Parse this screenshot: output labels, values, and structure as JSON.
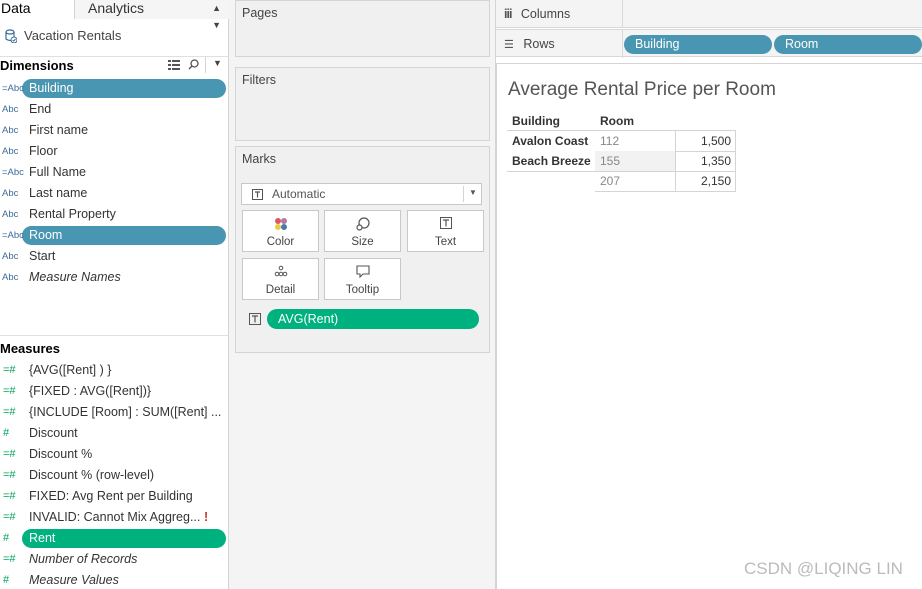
{
  "data_pane": {
    "tab_data": "Data",
    "tab_analytics": "Analytics",
    "datasource": "Vacation Rentals",
    "dimensions_header": "Dimensions",
    "dimensions": [
      {
        "type": "=Abc",
        "name": "Building",
        "selected": true
      },
      {
        "type": "Abc",
        "name": "End"
      },
      {
        "type": "Abc",
        "name": "First name"
      },
      {
        "type": "Abc",
        "name": "Floor"
      },
      {
        "type": "=Abc",
        "name": "Full Name"
      },
      {
        "type": "Abc",
        "name": "Last name"
      },
      {
        "type": "Abc",
        "name": "Rental Property"
      },
      {
        "type": "=Abc",
        "name": "Room",
        "selected": true
      },
      {
        "type": "Abc",
        "name": "Start"
      },
      {
        "type": "Abc",
        "name": "Measure Names",
        "italic": true
      }
    ],
    "measures_header": "Measures",
    "measures": [
      {
        "type": "=#",
        "name": "{AVG([Rent] ) }"
      },
      {
        "type": "=#",
        "name": "{FIXED : AVG([Rent])}"
      },
      {
        "type": "=#",
        "name": "{INCLUDE [Room] : SUM([Rent] ..."
      },
      {
        "type": "#",
        "name": "Discount"
      },
      {
        "type": "=#",
        "name": "Discount %"
      },
      {
        "type": "=#",
        "name": "Discount % (row-level)"
      },
      {
        "type": "=#",
        "name": "FIXED: Avg Rent per Building"
      },
      {
        "type": "=#",
        "name": "INVALID: Cannot Mix Aggreg...",
        "warning": "!"
      },
      {
        "type": "#",
        "name": "Rent",
        "selected": true
      },
      {
        "type": "=#",
        "name": "Number of Records",
        "italic": true
      },
      {
        "type": "#",
        "name": "Measure Values",
        "italic": true
      }
    ]
  },
  "cards": {
    "pages": "Pages",
    "filters": "Filters",
    "marks": "Marks",
    "mark_type": "Automatic",
    "buttons": {
      "color": "Color",
      "size": "Size",
      "text": "Text",
      "detail": "Detail",
      "tooltip": "Tooltip"
    },
    "text_pill": "AVG(Rent)"
  },
  "shelves": {
    "columns_label": "Columns",
    "rows_label": "Rows",
    "rows_pills": [
      "Building",
      "Room"
    ]
  },
  "view": {
    "title": "Average Rental Price per Room",
    "headers": [
      "Building",
      "Room"
    ],
    "rows": [
      {
        "building": "Avalon Coast",
        "room": "112",
        "value": "1,500"
      },
      {
        "building": "Beach Breeze",
        "room": "155",
        "value": "1,350"
      },
      {
        "building": "",
        "room": "207",
        "value": "2,150"
      }
    ]
  },
  "watermark": "CSDN @LIQING LIN",
  "colors": {
    "dimension_pill": "#4996b2",
    "measure_pill": "#00b180",
    "dimension_type": "#3d6b99",
    "measure_type": "#00a45a"
  }
}
